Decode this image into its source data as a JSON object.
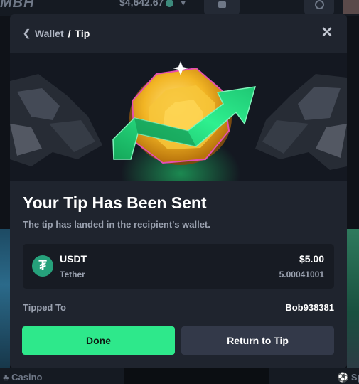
{
  "app": {
    "logo": "MBH",
    "balance": "$4,642.67",
    "nav": {
      "casino_label": "Casino",
      "sports_label": "Sp"
    }
  },
  "modal": {
    "breadcrumb": {
      "parent": "Wallet",
      "separator": "/",
      "current": "Tip"
    },
    "close_icon": "close-icon",
    "hero_image": "coin-with-green-arrow-illustration",
    "title": "Your Tip Has Been Sent",
    "subtitle": "The tip has landed in the recipient's wallet.",
    "token": {
      "icon": "tether-icon",
      "icon_glyph": "₮",
      "symbol": "USDT",
      "name": "Tether",
      "usd_value": "$5.00",
      "amount": "5.00041001"
    },
    "tipped_to": {
      "label": "Tipped To",
      "value": "Bob938381"
    },
    "buttons": {
      "done": "Done",
      "return": "Return to Tip"
    }
  },
  "colors": {
    "accent": "#2ee88b",
    "modal_bg": "#1f242e",
    "tether": "#26a17b"
  }
}
